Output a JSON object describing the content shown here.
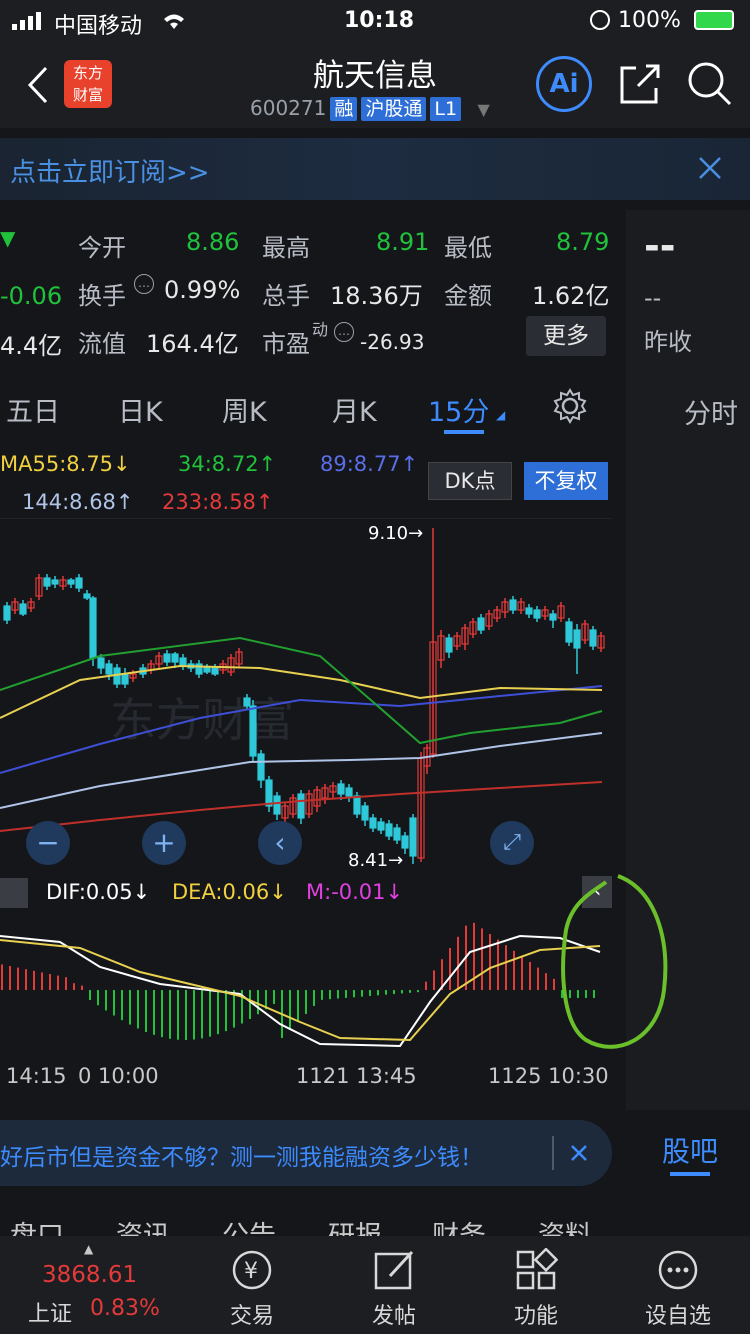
{
  "status": {
    "carrier": "中国移动",
    "time": "10:18",
    "battery": "100%"
  },
  "header": {
    "title": "航天信息",
    "code": "600271",
    "tags": [
      "融",
      "沪股通",
      "L1"
    ],
    "logo_line1": "东方",
    "logo_line2": "财富",
    "ai_label": "Ai"
  },
  "banner": {
    "text": "点击立即订阅>>"
  },
  "quote": {
    "left_col": [
      "-0.06",
      "4.4亿"
    ],
    "open_label": "今开",
    "open": "8.86",
    "high_label": "最高",
    "high": "8.91",
    "low_label": "最低",
    "low": "8.79",
    "turnover_label": "换手",
    "turnover": "0.99%",
    "volume_label": "总手",
    "volume": "18.36万",
    "amount_label": "金额",
    "amount": "1.62亿",
    "float_label": "流值",
    "float": "164.4亿",
    "pe_label": "市盈",
    "pe_sup": "动",
    "pe": "-26.93",
    "more_label": "更多"
  },
  "right_panel": {
    "dash1": "--",
    "dash2": "--",
    "prev_close_label": "昨收",
    "intraday_tab": "分时",
    "guba_tab": "股吧"
  },
  "tabs": [
    "五日",
    "日K",
    "周K",
    "月K",
    "15分"
  ],
  "active_tab": "15分",
  "ma": {
    "ma55": "MA55:8.75↓",
    "ma34": "34:8.72↑",
    "ma89": "89:8.77↑",
    "ma144": "144:8.68↑",
    "ma233": "233:8.58↑"
  },
  "buttons": {
    "dk": "DK点",
    "fq": "不复权"
  },
  "chart_labels": {
    "high": "9.10→",
    "low": "8.41→",
    "watermark": "东方财富"
  },
  "macd": {
    "dif": "DIF:0.05↓",
    "dea": "DEA:0.06↓",
    "m": "M:-0.01↓"
  },
  "time_axis": [
    "14:15",
    "0 10:00",
    "1121 13:45",
    "1125 10:30"
  ],
  "ad": {
    "text": "好后市但是资金不够？测一测我能融资多少钱！"
  },
  "subtabs": [
    "盘口",
    "资讯",
    "公告",
    "研报",
    "财务",
    "资料"
  ],
  "bottom": {
    "index_value": "3868.61",
    "index_name": "上证",
    "index_change": "0.83%",
    "items": [
      "交易",
      "发帖",
      "功能",
      "设自选"
    ]
  },
  "colors": {
    "up": "#e33a3a",
    "down": "#21c23b",
    "accent": "#3d8bfd"
  }
}
